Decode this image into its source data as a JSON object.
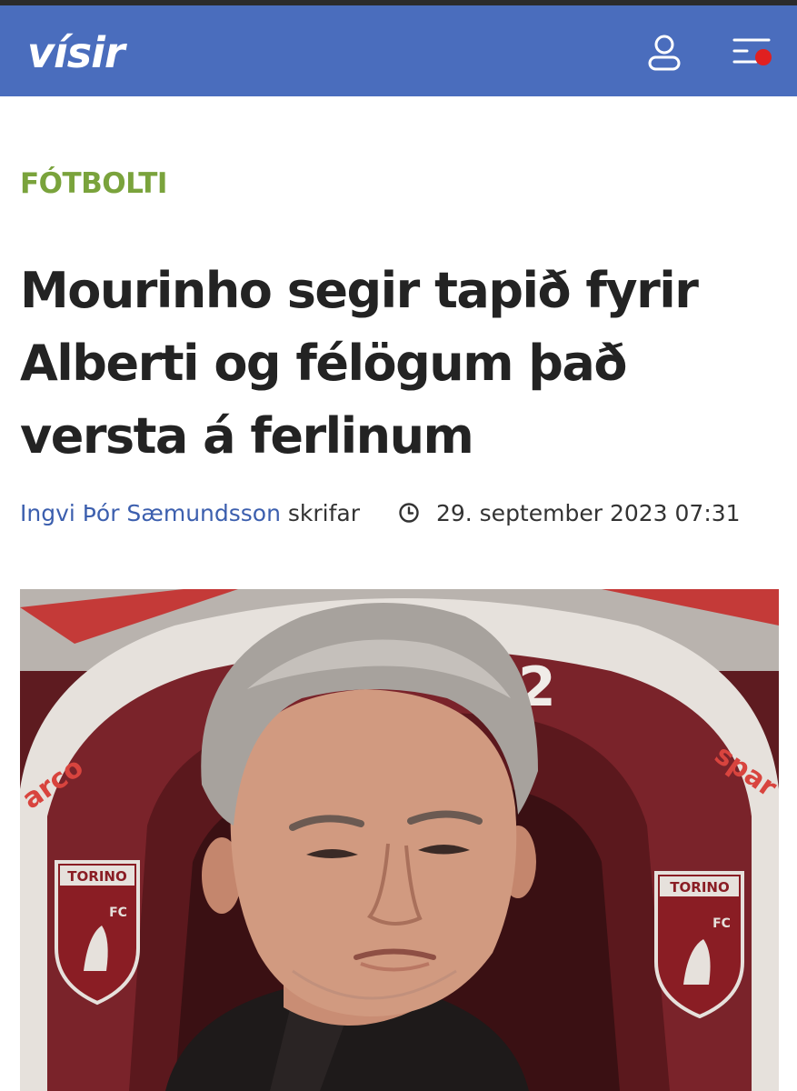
{
  "header": {
    "logo_text": "vísir",
    "background_color": "#4a6dbd",
    "user_icon": "user-icon",
    "menu_icon": "menu-icon",
    "notification_color": "#e02020"
  },
  "article": {
    "category": "FÓTBOLTI",
    "category_color": "#7aa33c",
    "title": "Mourinho segir tapið fyrir Alberti og félögum það versta á ferlinum",
    "author": "Ingvi Þór Sæmundsson",
    "author_suffix": "skrifar",
    "published": "29. september 2023 07:31",
    "clock_icon": "clock-icon"
  },
  "photo": {
    "seat_left_badge": "TORINO",
    "seat_right_badge": "TORINO",
    "badge_fc": "FC",
    "seat_left_logo": "arco",
    "seat_right_logo": "spar",
    "seat_number": "2"
  }
}
